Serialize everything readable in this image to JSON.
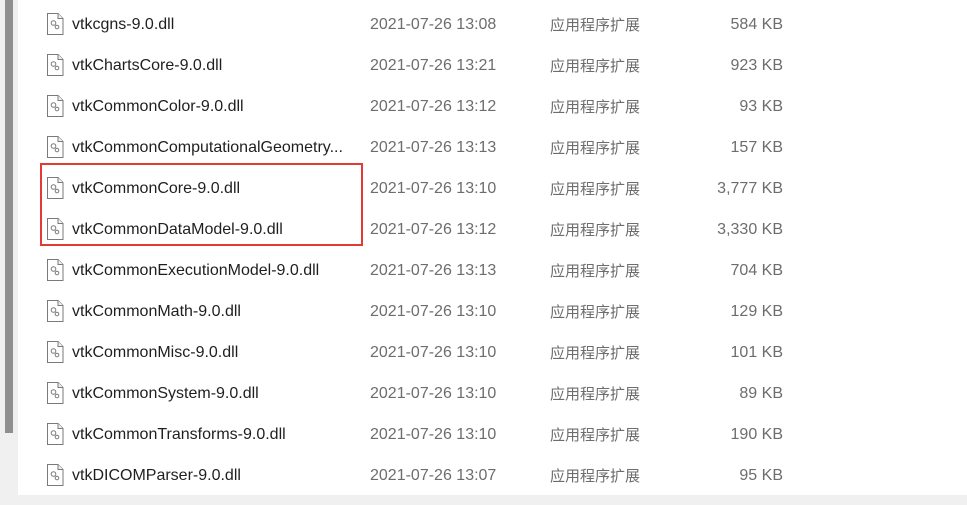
{
  "files": [
    {
      "name": "vtkcgns-9.0.dll",
      "modified": "2021-07-26 13:08",
      "type": "应用程序扩展",
      "size": "584 KB"
    },
    {
      "name": "vtkChartsCore-9.0.dll",
      "modified": "2021-07-26 13:21",
      "type": "应用程序扩展",
      "size": "923 KB"
    },
    {
      "name": "vtkCommonColor-9.0.dll",
      "modified": "2021-07-26 13:12",
      "type": "应用程序扩展",
      "size": "93 KB"
    },
    {
      "name": "vtkCommonComputationalGeometry...",
      "modified": "2021-07-26 13:13",
      "type": "应用程序扩展",
      "size": "157 KB"
    },
    {
      "name": "vtkCommonCore-9.0.dll",
      "modified": "2021-07-26 13:10",
      "type": "应用程序扩展",
      "size": "3,777 KB"
    },
    {
      "name": "vtkCommonDataModel-9.0.dll",
      "modified": "2021-07-26 13:12",
      "type": "应用程序扩展",
      "size": "3,330 KB"
    },
    {
      "name": "vtkCommonExecutionModel-9.0.dll",
      "modified": "2021-07-26 13:13",
      "type": "应用程序扩展",
      "size": "704 KB"
    },
    {
      "name": "vtkCommonMath-9.0.dll",
      "modified": "2021-07-26 13:10",
      "type": "应用程序扩展",
      "size": "129 KB"
    },
    {
      "name": "vtkCommonMisc-9.0.dll",
      "modified": "2021-07-26 13:10",
      "type": "应用程序扩展",
      "size": "101 KB"
    },
    {
      "name": "vtkCommonSystem-9.0.dll",
      "modified": "2021-07-26 13:10",
      "type": "应用程序扩展",
      "size": "89 KB"
    },
    {
      "name": "vtkCommonTransforms-9.0.dll",
      "modified": "2021-07-26 13:10",
      "type": "应用程序扩展",
      "size": "190 KB"
    },
    {
      "name": "vtkDICOMParser-9.0.dll",
      "modified": "2021-07-26 13:07",
      "type": "应用程序扩展",
      "size": "95 KB"
    }
  ],
  "colors": {
    "highlight_border": "#e53935",
    "secondary_text": "#6d6d6d",
    "primary_text": "#1f1f1f"
  },
  "icons": {
    "file": "dll-file-icon"
  }
}
